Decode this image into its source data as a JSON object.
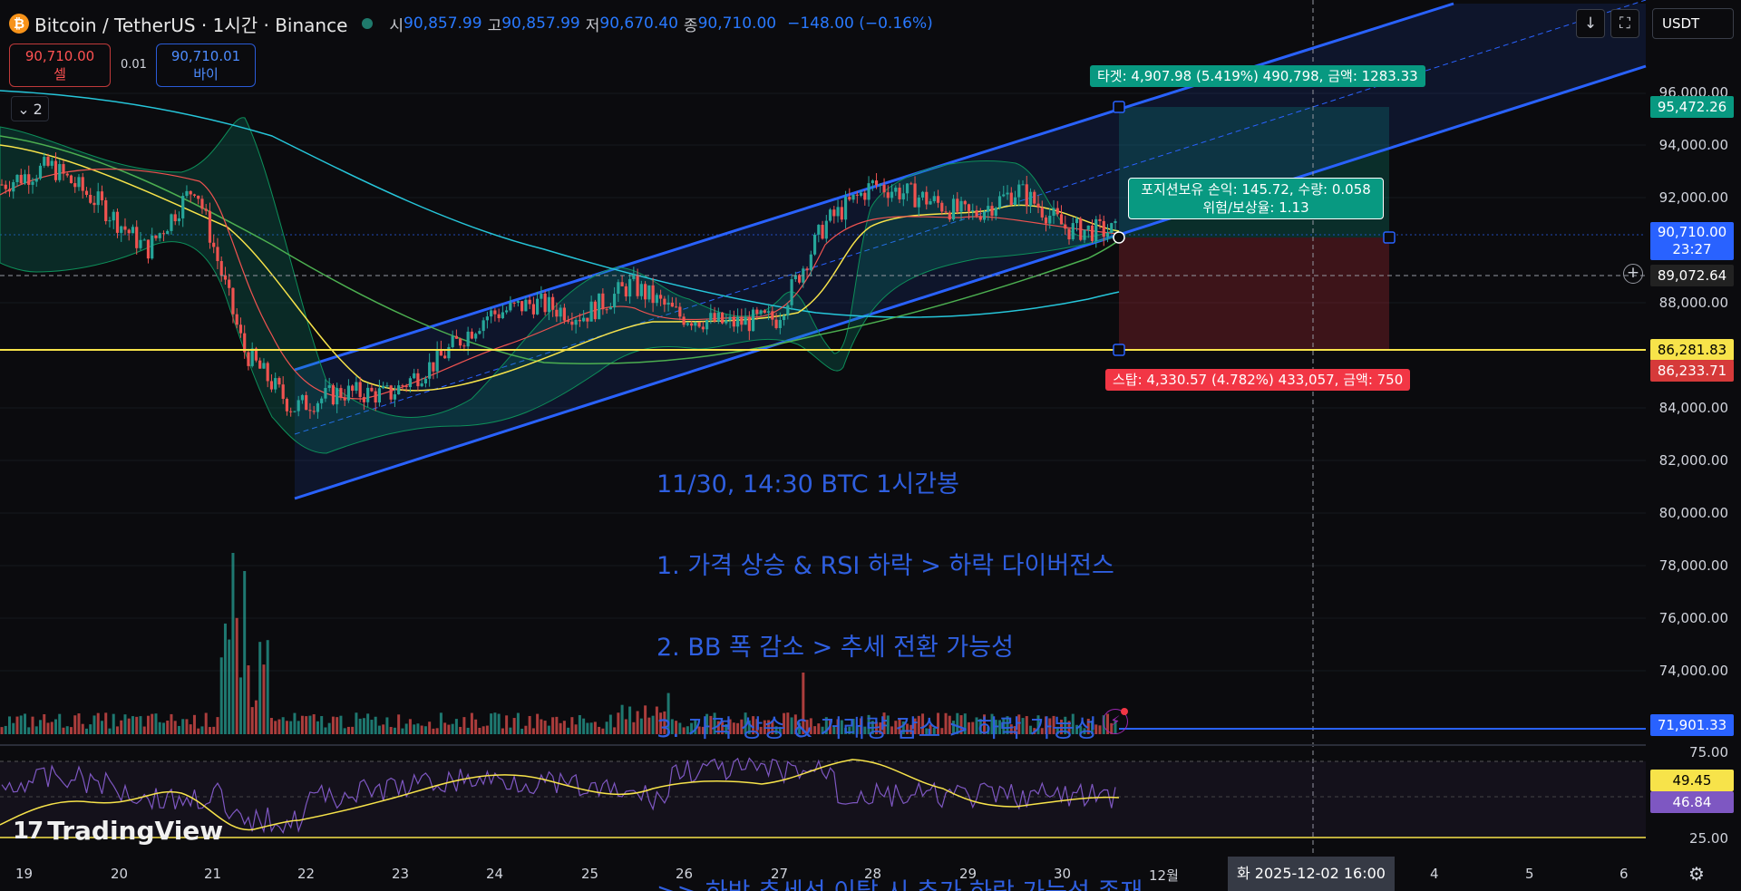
{
  "header": {
    "symbol": "Bitcoin / TetherUS · 1시간 · Binance",
    "open_label": "시",
    "open": "90,857.99",
    "high_label": "고",
    "high": "90,857.99",
    "low_label": "저",
    "low": "90,670.40",
    "close_label": "종",
    "close": "90,710.00",
    "change": "−148.00 (−0.16%)"
  },
  "trade": {
    "sell_price": "90,710.00",
    "sell_label": "셀",
    "buy_price": "90,710.01",
    "buy_label": "바이",
    "spread": "0.01"
  },
  "layers_count": "2",
  "currency": "USDT",
  "price_axis": [
    {
      "label": "96,000.00",
      "price": 96000
    },
    {
      "label": "94,000.00",
      "price": 94000
    },
    {
      "label": "92,000.00",
      "price": 92000
    },
    {
      "label": "88,000.00",
      "price": 88000
    },
    {
      "label": "84,000.00",
      "price": 84000
    },
    {
      "label": "82,000.00",
      "price": 82000
    },
    {
      "label": "80,000.00",
      "price": 80000
    },
    {
      "label": "78,000.00",
      "price": 78000
    },
    {
      "label": "76,000.00",
      "price": 76000
    },
    {
      "label": "74,000.00",
      "price": 74000
    }
  ],
  "price_tags": {
    "target": "95,472.26",
    "current": "90,710.00",
    "countdown": "23:27",
    "crosshair": "89,072.64",
    "support_line": "86,281.83",
    "stop": "86,233.71",
    "lower_line": "71,901.33"
  },
  "rsi_axis": {
    "upper": "75.00",
    "lower": "25.00",
    "ma": "49.45",
    "rsi": "46.84"
  },
  "time_axis": [
    "19",
    "20",
    "21",
    "22",
    "23",
    "24",
    "25",
    "26",
    "27",
    "28",
    "29",
    "30",
    "12월",
    "4",
    "5",
    "6"
  ],
  "crosshair_date": "화 2025-12-02   16:00",
  "position": {
    "target_text": "타겟: 4,907.98 (5.419%) 490,798, 금액: 1283.33",
    "stop_text": "스탑: 4,330.57 (4.782%) 433,057, 금액: 750",
    "pnl_line1": "포지션보유 손익: 145.72, 수량: 0.058",
    "pnl_line2": "위험/보상율: 1.13"
  },
  "note": {
    "line1": "11/30, 14:30 BTC 1시간봉",
    "line2": "1. 가격 상승 & RSI 하락 > 하락 다이버전스",
    "line3": "2. BB 폭 감소 > 추세 전환 가능성",
    "line4": "3. 가격 상승 & 거래량 감소 > 하락 가능성",
    "line5": ">> 하방 추세선 이탈 시 추가 하락 가능성 존재"
  },
  "watermark": "TradingView",
  "colors": {
    "background": "#0b0b0e",
    "channel": "#2962ff",
    "support": "#f7e34a",
    "target_zone": "#089981",
    "stop_zone": "#f23645",
    "rsi": "#7e57c2"
  },
  "chart_data": {
    "type": "line",
    "series": [
      {
        "name": "",
        "x": [
          "11-19 00:00",
          "11-19 12:00",
          "11-20 00:00",
          "11-20 12:00",
          "11-21 00:00",
          "11-21 12:00",
          "11-22 00:00",
          "11-22 12:00",
          "11-23 00:00",
          "11-23 12:00",
          "11-24 00:00",
          "11-24 12:00",
          "11-25 00:00",
          "11-25 12:00",
          "11-26 00:00",
          "11-26 12:00",
          "11-27 00:00",
          "11-27 12:00",
          "11-28 00:00",
          "11-28 12:00",
          "11-29 00:00",
          "11-29 12:00",
          "11-30 00:00",
          "11-30 14:00"
        ],
        "values": [
          92500,
          93200,
          91800,
          90000,
          92500,
          86200,
          84000,
          84600,
          84500,
          85800,
          87500,
          88000,
          87500,
          88700,
          87500,
          87200,
          87400,
          91000,
          92500,
          92000,
          91300,
          92300,
          90800,
          90710
        ]
      }
    ],
    "ylim": [
      70500,
      97500
    ]
  }
}
